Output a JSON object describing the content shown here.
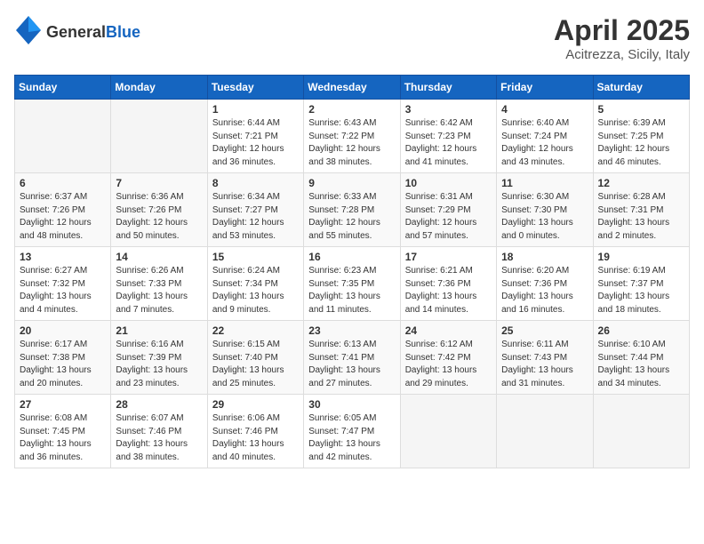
{
  "header": {
    "logo_general": "General",
    "logo_blue": "Blue",
    "month_year": "April 2025",
    "location": "Acitrezza, Sicily, Italy"
  },
  "weekdays": [
    "Sunday",
    "Monday",
    "Tuesday",
    "Wednesday",
    "Thursday",
    "Friday",
    "Saturday"
  ],
  "weeks": [
    [
      {
        "day": "",
        "info": ""
      },
      {
        "day": "",
        "info": ""
      },
      {
        "day": "1",
        "info": "Sunrise: 6:44 AM\nSunset: 7:21 PM\nDaylight: 12 hours\nand 36 minutes."
      },
      {
        "day": "2",
        "info": "Sunrise: 6:43 AM\nSunset: 7:22 PM\nDaylight: 12 hours\nand 38 minutes."
      },
      {
        "day": "3",
        "info": "Sunrise: 6:42 AM\nSunset: 7:23 PM\nDaylight: 12 hours\nand 41 minutes."
      },
      {
        "day": "4",
        "info": "Sunrise: 6:40 AM\nSunset: 7:24 PM\nDaylight: 12 hours\nand 43 minutes."
      },
      {
        "day": "5",
        "info": "Sunrise: 6:39 AM\nSunset: 7:25 PM\nDaylight: 12 hours\nand 46 minutes."
      }
    ],
    [
      {
        "day": "6",
        "info": "Sunrise: 6:37 AM\nSunset: 7:26 PM\nDaylight: 12 hours\nand 48 minutes."
      },
      {
        "day": "7",
        "info": "Sunrise: 6:36 AM\nSunset: 7:26 PM\nDaylight: 12 hours\nand 50 minutes."
      },
      {
        "day": "8",
        "info": "Sunrise: 6:34 AM\nSunset: 7:27 PM\nDaylight: 12 hours\nand 53 minutes."
      },
      {
        "day": "9",
        "info": "Sunrise: 6:33 AM\nSunset: 7:28 PM\nDaylight: 12 hours\nand 55 minutes."
      },
      {
        "day": "10",
        "info": "Sunrise: 6:31 AM\nSunset: 7:29 PM\nDaylight: 12 hours\nand 57 minutes."
      },
      {
        "day": "11",
        "info": "Sunrise: 6:30 AM\nSunset: 7:30 PM\nDaylight: 13 hours\nand 0 minutes."
      },
      {
        "day": "12",
        "info": "Sunrise: 6:28 AM\nSunset: 7:31 PM\nDaylight: 13 hours\nand 2 minutes."
      }
    ],
    [
      {
        "day": "13",
        "info": "Sunrise: 6:27 AM\nSunset: 7:32 PM\nDaylight: 13 hours\nand 4 minutes."
      },
      {
        "day": "14",
        "info": "Sunrise: 6:26 AM\nSunset: 7:33 PM\nDaylight: 13 hours\nand 7 minutes."
      },
      {
        "day": "15",
        "info": "Sunrise: 6:24 AM\nSunset: 7:34 PM\nDaylight: 13 hours\nand 9 minutes."
      },
      {
        "day": "16",
        "info": "Sunrise: 6:23 AM\nSunset: 7:35 PM\nDaylight: 13 hours\nand 11 minutes."
      },
      {
        "day": "17",
        "info": "Sunrise: 6:21 AM\nSunset: 7:36 PM\nDaylight: 13 hours\nand 14 minutes."
      },
      {
        "day": "18",
        "info": "Sunrise: 6:20 AM\nSunset: 7:36 PM\nDaylight: 13 hours\nand 16 minutes."
      },
      {
        "day": "19",
        "info": "Sunrise: 6:19 AM\nSunset: 7:37 PM\nDaylight: 13 hours\nand 18 minutes."
      }
    ],
    [
      {
        "day": "20",
        "info": "Sunrise: 6:17 AM\nSunset: 7:38 PM\nDaylight: 13 hours\nand 20 minutes."
      },
      {
        "day": "21",
        "info": "Sunrise: 6:16 AM\nSunset: 7:39 PM\nDaylight: 13 hours\nand 23 minutes."
      },
      {
        "day": "22",
        "info": "Sunrise: 6:15 AM\nSunset: 7:40 PM\nDaylight: 13 hours\nand 25 minutes."
      },
      {
        "day": "23",
        "info": "Sunrise: 6:13 AM\nSunset: 7:41 PM\nDaylight: 13 hours\nand 27 minutes."
      },
      {
        "day": "24",
        "info": "Sunrise: 6:12 AM\nSunset: 7:42 PM\nDaylight: 13 hours\nand 29 minutes."
      },
      {
        "day": "25",
        "info": "Sunrise: 6:11 AM\nSunset: 7:43 PM\nDaylight: 13 hours\nand 31 minutes."
      },
      {
        "day": "26",
        "info": "Sunrise: 6:10 AM\nSunset: 7:44 PM\nDaylight: 13 hours\nand 34 minutes."
      }
    ],
    [
      {
        "day": "27",
        "info": "Sunrise: 6:08 AM\nSunset: 7:45 PM\nDaylight: 13 hours\nand 36 minutes."
      },
      {
        "day": "28",
        "info": "Sunrise: 6:07 AM\nSunset: 7:46 PM\nDaylight: 13 hours\nand 38 minutes."
      },
      {
        "day": "29",
        "info": "Sunrise: 6:06 AM\nSunset: 7:46 PM\nDaylight: 13 hours\nand 40 minutes."
      },
      {
        "day": "30",
        "info": "Sunrise: 6:05 AM\nSunset: 7:47 PM\nDaylight: 13 hours\nand 42 minutes."
      },
      {
        "day": "",
        "info": ""
      },
      {
        "day": "",
        "info": ""
      },
      {
        "day": "",
        "info": ""
      }
    ]
  ]
}
